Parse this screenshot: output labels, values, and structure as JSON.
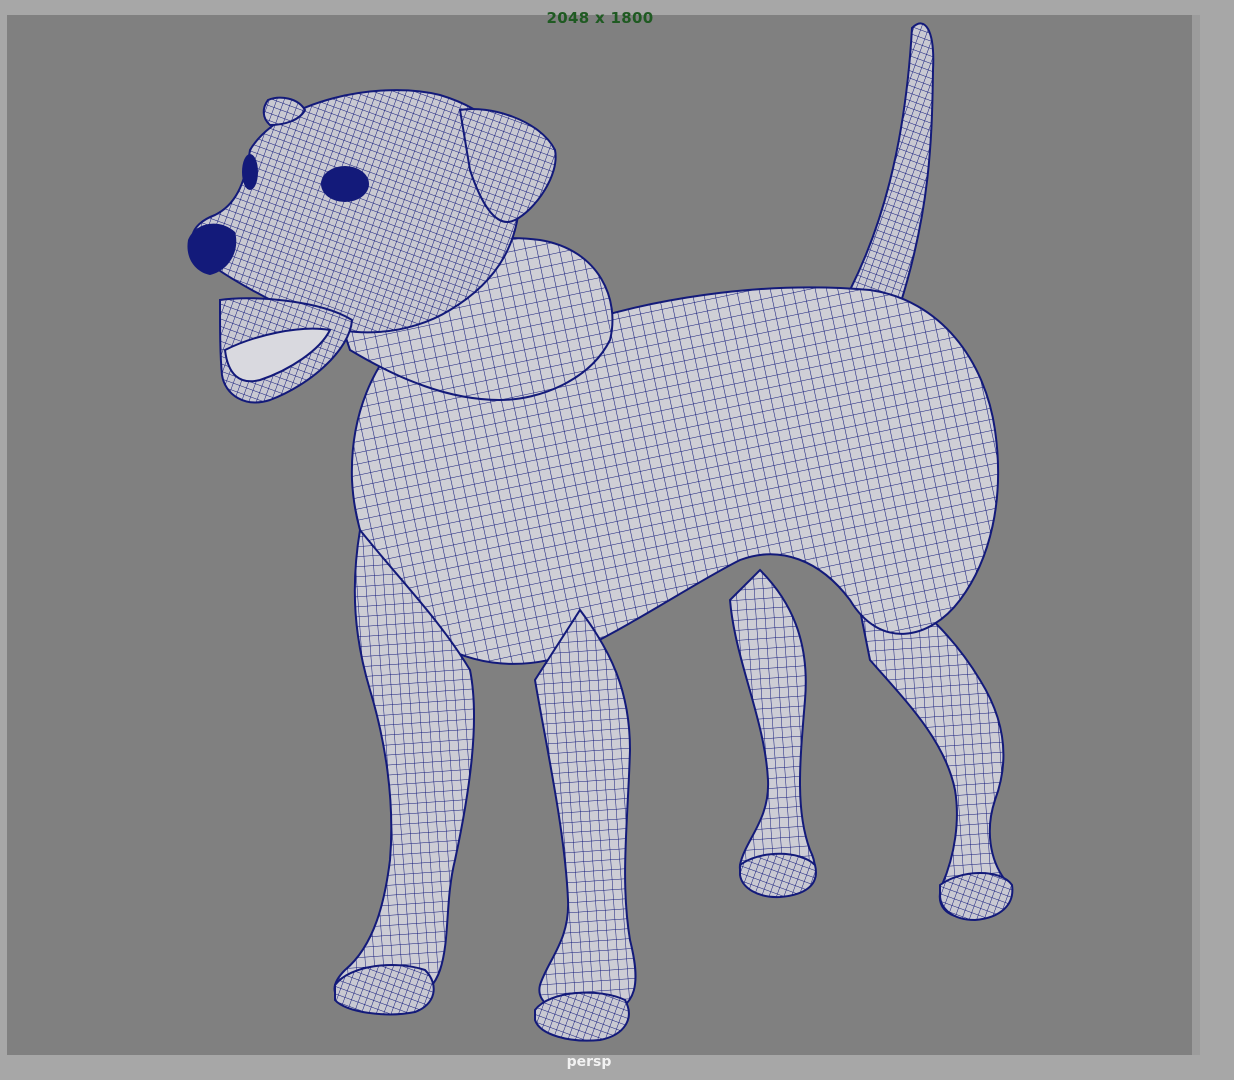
{
  "viewport": {
    "resolution_text": "2048 x 1800",
    "camera_name": "persp",
    "model_icon": "dog-wireframe-mesh"
  },
  "colors": {
    "background_outer": "#a7a7a7",
    "gate_fill": "#808080",
    "resolution_text": "#1f5a22",
    "camera_text": "#f2f2f2",
    "mesh_surface": "#cfcfd6",
    "wireframe": "#131a7a"
  }
}
